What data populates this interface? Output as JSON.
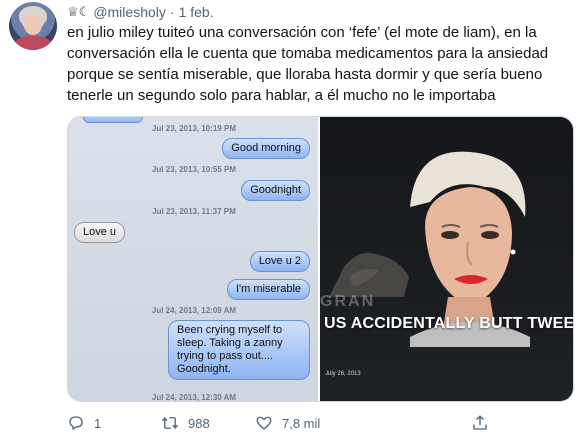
{
  "tweet": {
    "header_emoji": "♕☾",
    "handle": "@milesholy",
    "separator": "·",
    "date": "1 feb.",
    "text": "en julio miley tuiteó una conversación con ‘fefe’ (el mote de liam), en la conversación ella le cuenta que tomaba medicamentos para la ansiedad porque se sentía miserable, que lloraba hasta dormir y que sería bueno tenerle un segundo solo para hablar, a él mucho no le importaba"
  },
  "sms": {
    "times": [
      "Jul 23, 2013, 10:19 PM",
      "Jul 23, 2013, 10:55 PM",
      "Jul 23, 2013, 11:37 PM",
      "Jul 24, 2013, 12:09 AM",
      "Jul 24, 2013, 12:30 AM"
    ],
    "messages": [
      {
        "text": "Good morning",
        "dir": "out"
      },
      {
        "text": "Goodnight",
        "dir": "out"
      },
      {
        "text": "Love u",
        "dir": "in"
      },
      {
        "text": "Love u 2",
        "dir": "out"
      },
      {
        "text": "I'm miserable",
        "dir": "out"
      },
      {
        "text": "Been crying myself to\nsleep. Taking a zanny\ntrying to pass out....\nGoodnight.",
        "dir": "out"
      }
    ]
  },
  "photo": {
    "headline": "US ACCIDENTALLY BUTT TWEETS",
    "date": "July 26, 2013",
    "background_text": "GRAN"
  },
  "actions": {
    "reply_count": "1",
    "retweet_count": "988",
    "like_count": "7,8 mil"
  },
  "colors": {
    "secondary_text": "#536471",
    "primary_text": "#0f1419",
    "lipstick": "#d8262b"
  },
  "icons": [
    "reply-icon",
    "retweet-icon",
    "like-icon",
    "share-icon"
  ]
}
